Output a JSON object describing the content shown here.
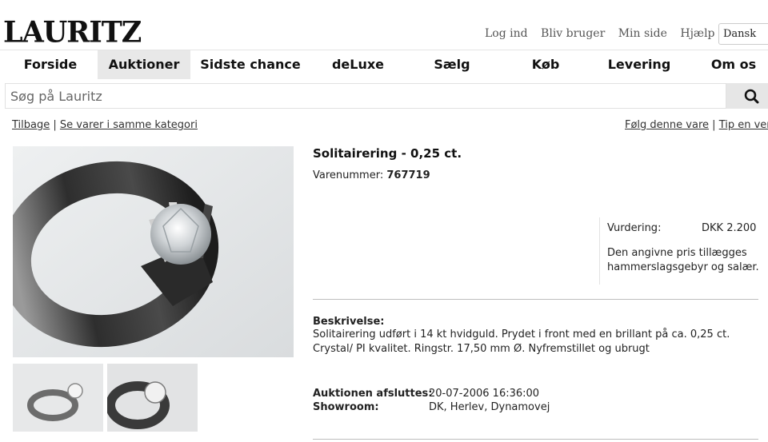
{
  "header": {
    "logo": "LAURITZ",
    "links": [
      "Log ind",
      "Bliv bruger",
      "Min side",
      "Hjælp"
    ],
    "language": "Dansk"
  },
  "nav": [
    "Forside",
    "Auktioner",
    "Sidste chance",
    "deLuxe",
    "Sælg",
    "Køb",
    "Levering",
    "Om os"
  ],
  "search": {
    "placeholder": "Søg på Lauritz"
  },
  "breadcrumb": {
    "back": "Tilbage",
    "sep": "|",
    "same_category": "Se varer i samme kategori"
  },
  "actions": {
    "follow": "Følg denne vare",
    "sep": "|",
    "tip": "Tip en ven"
  },
  "item": {
    "title": "Solitairering - 0,25 ct.",
    "number_label": "Varenummer:",
    "number": "767719",
    "valuation_label": "Vurdering:",
    "valuation": "DKK  2.200",
    "valuation_note": "Den angivne pris tillægges hammerslagsgebyr og salær.",
    "description_label": "Beskrivelse:",
    "description": "Solitairering udført i 14 kt hvidguld. Prydet i front med en brillant på ca. 0,25 ct. Crystal/ PI kvalitet. Ringstr. 17,50 mm Ø. Nyfremstillet og ubrugt",
    "end_label": "Auktionen afsluttes:",
    "end_value": "20-07-2006 16:36:00",
    "showroom_label": "Showroom:",
    "showroom_value": "DK, Herlev, Dynamovej"
  },
  "icons": {
    "search": "search-icon"
  },
  "colors": {
    "nav_active_bg": "#e8e8e8",
    "search_button_bg": "#e6e6e6"
  }
}
